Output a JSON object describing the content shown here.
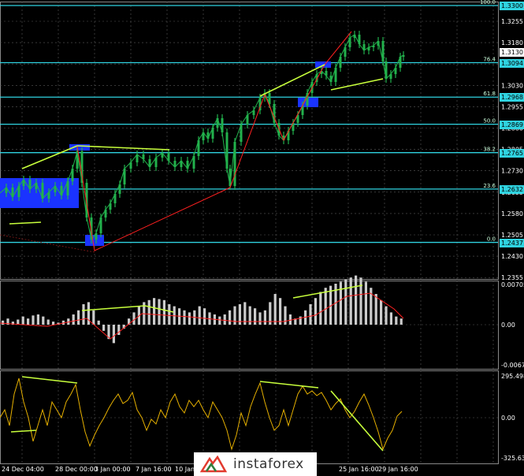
{
  "colors": {
    "background": "#000000",
    "grid": "#5a5a5a",
    "candle": "#22b14c",
    "fib_level": "#2fd3e0",
    "trend_line": "#c8ff3c",
    "zigzag": "#ff2020",
    "fractal_box": "#1a33ff",
    "histogram": "#cccccc",
    "signal_line": "#ff2020",
    "oscillator": "#e6b000",
    "price_badge": "#ffffff",
    "level_badge": "#2fd3e0",
    "axis_text": "#ffffff"
  },
  "price_axis": [
    "1.3255",
    "1.3180",
    "1.3105",
    "1.3030",
    "1.2955",
    "1.2880",
    "1.2805",
    "1.2730",
    "1.2655",
    "1.2580",
    "1.2505",
    "1.2430",
    "1.2355"
  ],
  "current_price": "1.3130",
  "fib_levels": [
    {
      "label": "100.0",
      "badge": "1.3300",
      "value": 1.33
    },
    {
      "label": "76.4",
      "badge": "1.3094",
      "value": 1.3094
    },
    {
      "label": "61.8",
      "badge": "1.2968",
      "value": 1.2968
    },
    {
      "label": "50.0",
      "badge": "1.2869",
      "value": 1.2869
    },
    {
      "label": "38.2",
      "badge": "1.2765",
      "value": 1.2765
    },
    {
      "label": "23.6",
      "badge": "1.2632",
      "value": 1.2632
    },
    {
      "label": "0.0",
      "badge": "1.2437",
      "value": 1.2437
    }
  ],
  "macd_axis": [
    "0.00705",
    "0.00",
    "-0.00677"
  ],
  "cci_axis": [
    "295.4989",
    "0.00",
    "-325.630"
  ],
  "time_axis": [
    "24 Dec 04:00",
    "28 Dec 00:00",
    "3 Jan 00:00",
    "7 Jan 16:00",
    "10 Jan",
    "25 Jan 16:00",
    "29 Jan 16:00"
  ],
  "watermark": {
    "text": "instaforex",
    "icon": "instaforex-logo-icon"
  },
  "chart_data": {
    "type": "line",
    "title": "",
    "series": [
      {
        "x": [
          "24 Dec 04:00",
          "28 Dec 00:00",
          "3 Jan 00:00",
          "7 Jan 16:00",
          "10 Jan",
          "25 Jan 16:00",
          "29 Jan 16:00"
        ],
        "values": [
          1.266,
          1.281,
          1.244,
          1.279,
          1.285,
          1.319,
          1.313
        ]
      }
    ],
    "ylim": [
      1.2355,
      1.33
    ],
    "grid": true,
    "legend": "none"
  }
}
